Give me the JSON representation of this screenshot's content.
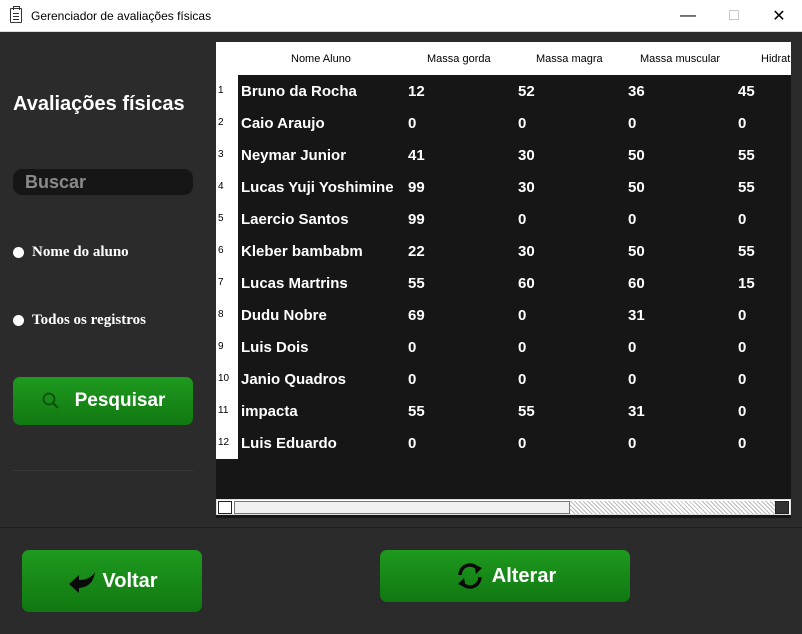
{
  "window": {
    "title": "Gerenciador de avaliações físicas"
  },
  "sidebar": {
    "heading": "Avaliações físicas",
    "search_placeholder": "Buscar",
    "radio_name": "Nome do aluno",
    "radio_all": "Todos os registros",
    "search_button": "Pesquisar"
  },
  "table": {
    "columns": [
      "Nome Aluno",
      "Massa gorda",
      "Massa magra",
      "Massa muscular",
      "Hidrat"
    ],
    "row_numbers": [
      "1",
      "2",
      "3",
      "4",
      "5",
      "6",
      "7",
      "8",
      "9",
      "10",
      "11",
      "12"
    ],
    "rows": [
      [
        "Bruno da Rocha",
        "12",
        "52",
        "36",
        "45"
      ],
      [
        "Caio Araujo",
        "0",
        "0",
        "0",
        "0"
      ],
      [
        "Neymar Junior",
        "41",
        "30",
        "50",
        "55"
      ],
      [
        "Lucas Yuji Yoshimine",
        "99",
        "30",
        "50",
        "55"
      ],
      [
        "Laercio Santos",
        "99",
        "0",
        "0",
        "0"
      ],
      [
        "Kleber bambabm",
        "22",
        "30",
        "50",
        "55"
      ],
      [
        "Lucas Martrins",
        "55",
        "60",
        "60",
        "15"
      ],
      [
        "Dudu Nobre",
        "69",
        "0",
        "31",
        "0"
      ],
      [
        "Luis Dois",
        "0",
        "0",
        "0",
        "0"
      ],
      [
        "Janio Quadros",
        "0",
        "0",
        "0",
        "0"
      ],
      [
        "impacta",
        "55",
        "55",
        "31",
        "0"
      ],
      [
        "Luis Eduardo",
        "0",
        "0",
        "0",
        "0"
      ]
    ]
  },
  "footer": {
    "back_button": "Voltar",
    "edit_button": "Alterar"
  },
  "colors": {
    "accent": "#1a8f1a",
    "panel": "#2b2b2b",
    "table_bg": "#161616"
  }
}
